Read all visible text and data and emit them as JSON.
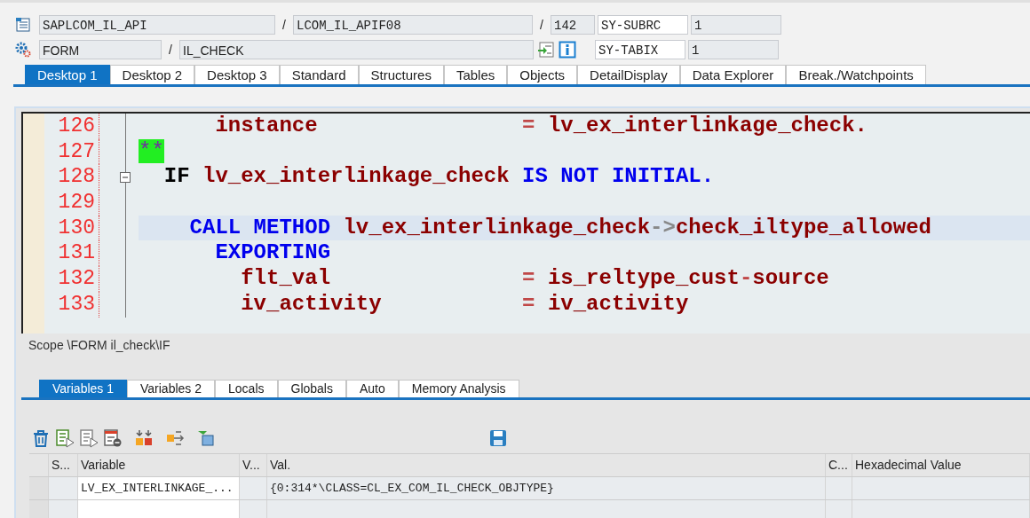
{
  "header": {
    "program": "SAPLCOM_IL_API",
    "include": "LCOM_IL_APIF08",
    "line": "142",
    "event_type": "FORM",
    "event": "IL_CHECK",
    "separators": [
      "/",
      "/",
      "/"
    ],
    "sysfields": [
      {
        "name": "SY-SUBRC",
        "value": "1"
      },
      {
        "name": "SY-TABIX",
        "value": "1"
      }
    ]
  },
  "top_tabs": [
    {
      "label": "Desktop 1",
      "selected": true
    },
    {
      "label": "Desktop 2",
      "selected": false
    },
    {
      "label": "Desktop 3",
      "selected": false
    },
    {
      "label": "Standard",
      "selected": false
    },
    {
      "label": "Structures",
      "selected": false
    },
    {
      "label": "Tables",
      "selected": false
    },
    {
      "label": "Objects",
      "selected": false
    },
    {
      "label": "DetailDisplay",
      "selected": false
    },
    {
      "label": "Data Explorer",
      "selected": false
    },
    {
      "label": "Break./Watchpoints",
      "selected": false
    }
  ],
  "editor": {
    "lines": [
      {
        "number": "126",
        "highlighted": false,
        "collapsible": false,
        "tokens": [
          {
            "kind": "ident",
            "text": "      instance"
          },
          {
            "kind": "op",
            "text": "                ="
          },
          {
            "kind": "ident",
            "text": " lv_ex_interlinkage_check."
          }
        ]
      },
      {
        "number": "127",
        "highlighted": false,
        "collapsible": false,
        "tokens": [
          {
            "kind": "comment",
            "text": "**"
          }
        ]
      },
      {
        "number": "128",
        "highlighted": false,
        "collapsible": true,
        "tokens": [
          {
            "kind": "plain",
            "text": "  IF"
          },
          {
            "kind": "ident",
            "text": " lv_ex_interlinkage_check"
          },
          {
            "kind": "keyword",
            "text": " IS NOT INITIAL."
          }
        ]
      },
      {
        "number": "129",
        "highlighted": false,
        "collapsible": false
      },
      {
        "number": "130",
        "highlighted": true,
        "collapsible": false,
        "tokens": [
          {
            "kind": "keyword",
            "text": "    CALL METHOD"
          },
          {
            "kind": "ident",
            "text": " lv_ex_interlinkage_check"
          },
          {
            "kind": "arrow",
            "text": "->"
          },
          {
            "kind": "ident",
            "text": "check_iltype_allowed"
          }
        ]
      },
      {
        "number": "131",
        "highlighted": false,
        "collapsible": false,
        "tokens": [
          {
            "kind": "keyword",
            "text": "      EXPORTING"
          }
        ]
      },
      {
        "number": "132",
        "highlighted": false,
        "collapsible": false,
        "tokens": [
          {
            "kind": "ident",
            "text": "        flt_val"
          },
          {
            "kind": "op",
            "text": "               ="
          },
          {
            "kind": "ident",
            "text": " is_reltype_cust"
          },
          {
            "kind": "op",
            "text": "-"
          },
          {
            "kind": "ident",
            "text": "source"
          }
        ]
      },
      {
        "number": "133",
        "highlighted": false,
        "collapsible": false,
        "tokens": [
          {
            "kind": "ident",
            "text": "        iv_activity"
          },
          {
            "kind": "op",
            "text": "           ="
          },
          {
            "kind": "ident",
            "text": " iv_activity"
          }
        ]
      }
    ]
  },
  "scope": "Scope \\FORM il_check\\IF",
  "bottom_tabs": [
    {
      "label": "Variables 1",
      "selected": true
    },
    {
      "label": "Variables 2",
      "selected": false
    },
    {
      "label": "Locals",
      "selected": false
    },
    {
      "label": "Globals",
      "selected": false
    },
    {
      "label": "Auto",
      "selected": false
    },
    {
      "label": "Memory Analysis",
      "selected": false
    }
  ],
  "variables_table": {
    "columns": [
      "S...",
      "Variable",
      "V...",
      "Val.",
      "C...",
      "Hexadecimal Value"
    ],
    "rows": [
      {
        "variable": "LV_EX_INTERLINKAGE_...",
        "value": "{0:314*\\CLASS=CL_EX_COM_IL_CHECK_OBJTYPE}"
      }
    ]
  }
}
